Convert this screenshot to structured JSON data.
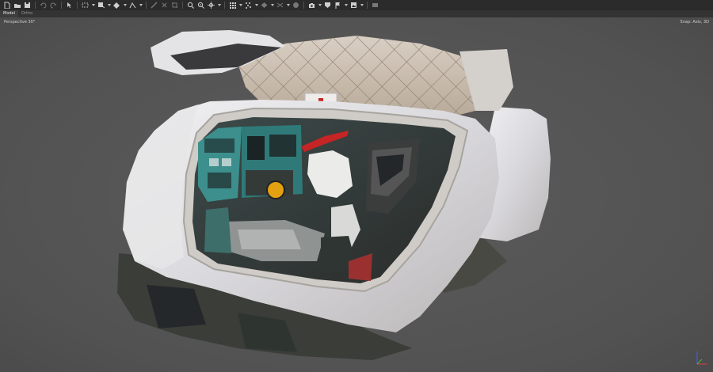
{
  "toolbar": {
    "icons": [
      {
        "name": "new-file-icon",
        "color": "#cfcfcf"
      },
      {
        "name": "open-folder-icon",
        "color": "#cfcfcf"
      },
      {
        "name": "save-icon",
        "color": "#cfcfcf"
      },
      {
        "name": "undo-icon",
        "color": "#777777"
      },
      {
        "name": "redo-icon",
        "color": "#777777"
      },
      {
        "name": "select-arrow-icon",
        "color": "#cfcfcf"
      },
      {
        "name": "rect-select-icon",
        "color": "#cfcfcf"
      },
      {
        "name": "move-icon",
        "color": "#cfcfcf"
      },
      {
        "name": "rotate-icon",
        "color": "#cfcfcf"
      },
      {
        "name": "draw-icon",
        "color": "#cfcfcf"
      },
      {
        "name": "ruler-icon",
        "color": "#777777"
      },
      {
        "name": "delete-icon",
        "color": "#777777"
      },
      {
        "name": "crop-icon",
        "color": "#777777"
      },
      {
        "name": "zoom-in-icon",
        "color": "#cfcfcf"
      },
      {
        "name": "zoom-out-icon",
        "color": "#cfcfcf"
      },
      {
        "name": "navigate-icon",
        "color": "#cfcfcf"
      },
      {
        "name": "grid-view-icon",
        "color": "#cfcfcf"
      },
      {
        "name": "points-icon",
        "color": "#cfcfcf"
      },
      {
        "name": "shaded-icon",
        "color": "#777777"
      },
      {
        "name": "texture-icon",
        "color": "#777777"
      },
      {
        "name": "tiled-icon",
        "color": "#777777"
      },
      {
        "name": "camera-icon",
        "color": "#cfcfcf"
      },
      {
        "name": "shape-icon",
        "color": "#cfcfcf"
      },
      {
        "name": "marker-flag-icon",
        "color": "#cfcfcf"
      },
      {
        "name": "image-icon",
        "color": "#cfcfcf"
      },
      {
        "name": "extra-icon",
        "color": "#777777"
      }
    ]
  },
  "tabs": [
    {
      "label": "Model",
      "active": true
    },
    {
      "label": "Ortho",
      "active": false
    }
  ],
  "viewport": {
    "projection_label": "Perspective 30°",
    "snap_label": "Snap: Axis, 3D",
    "background": "#565656",
    "subject": "3D model of aircraft cockpit section with open canopy"
  },
  "axis_indicator": {
    "x_color": "#d94040",
    "y_color": "#40c040",
    "z_color": "#4060ff"
  }
}
